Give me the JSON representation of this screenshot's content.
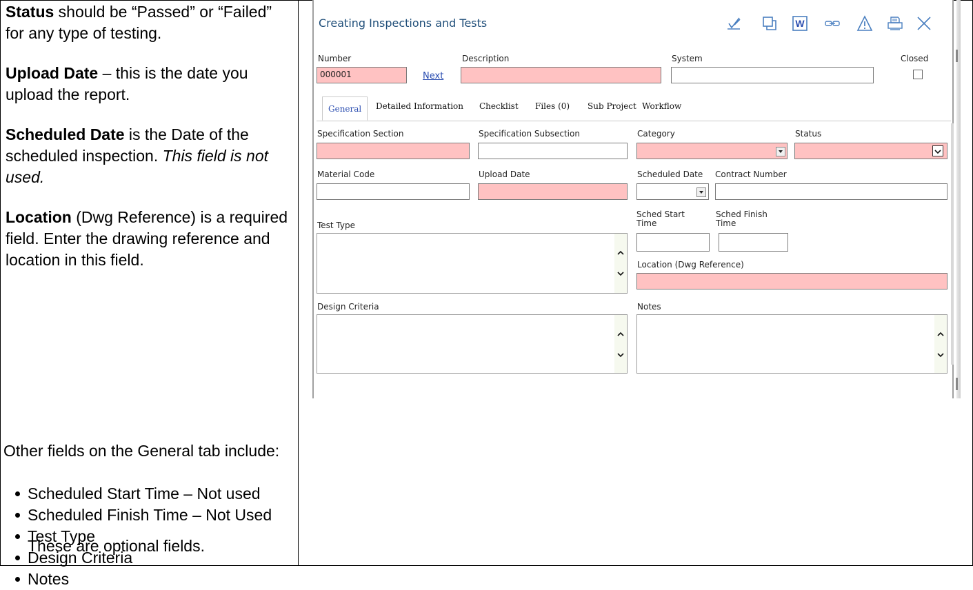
{
  "instructions": {
    "status_term": "Status",
    "status_text": " should be “Passed” or “Failed” for any type of testing.",
    "upload_term": "Upload Date",
    "upload_text": " – this is the date you upload the report.",
    "scheduled_term": "Scheduled Date",
    "scheduled_text": " is the Date of the scheduled inspection.  ",
    "scheduled_note": "This field is not used.",
    "location_term": "Location",
    "location_text": " (Dwg Reference) is a required field.  Enter the drawing reference and location in this field.",
    "other_intro": "Other fields on the General tab include:",
    "bullets": [
      "Scheduled Start Time – Not used",
      "Scheduled Finish Time – Not Used",
      "Test Type",
      "Design Criteria",
      "Notes"
    ],
    "optional_note": "These are optional fields."
  },
  "window": {
    "title": "Creating Inspections and Tests",
    "toolbar_icons": [
      "checkmark-edit-icon",
      "copy-icon",
      "word-icon",
      "link-icon",
      "warning-icon",
      "print-icon",
      "close-icon"
    ],
    "word_letter": "W"
  },
  "header": {
    "number_label": "Number",
    "number_value": "000001",
    "next_link": "Next",
    "description_label": "Description",
    "system_label": "System",
    "closed_label": "Closed"
  },
  "tabs": [
    {
      "label": "General",
      "active": true
    },
    {
      "label": "Detailed Information",
      "active": false
    },
    {
      "label": "Checklist",
      "active": false
    },
    {
      "label": "Files (0)",
      "active": false
    },
    {
      "label": "Sub Project",
      "active": false
    },
    {
      "label": "Workflow",
      "active": false
    }
  ],
  "general": {
    "spec_section_label": "Specification Section",
    "spec_subsection_label": "Specification Subsection",
    "category_label": "Category",
    "status_label": "Status",
    "material_code_label": "Material Code",
    "upload_date_label": "Upload Date",
    "scheduled_date_label": "Scheduled Date",
    "contract_number_label": "Contract Number",
    "test_type_label": "Test Type",
    "sched_start_label_1": "Sched Start",
    "sched_start_label_2": "Time",
    "sched_finish_label_1": "Sched Finish",
    "sched_finish_label_2": "Time",
    "location_label": "Location (Dwg Reference)",
    "design_criteria_label": "Design Criteria",
    "notes_label": "Notes"
  },
  "colors": {
    "required_field": "#ffc2c2",
    "title_blue": "#1f4e79",
    "link_blue": "#2a4db0",
    "icon_blue": "#4a7fc0"
  }
}
